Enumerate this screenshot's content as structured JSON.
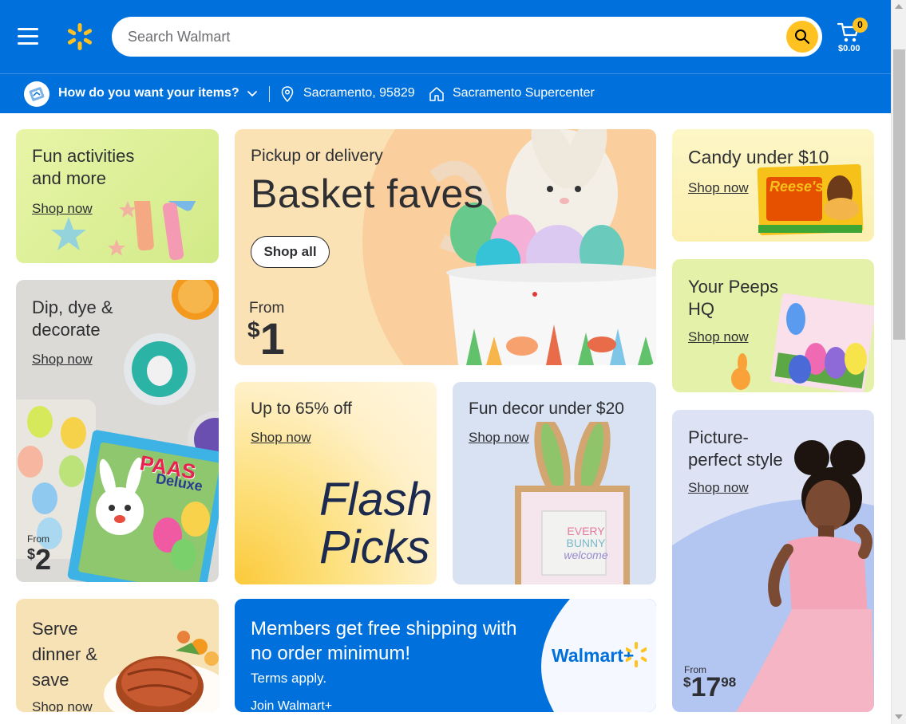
{
  "header": {
    "search_placeholder": "Search Walmart",
    "cart_count": "0",
    "cart_total": "$0.00"
  },
  "subheader": {
    "fulfillment_prompt": "How do you want your items?",
    "location": "Sacramento, 95829",
    "store": "Sacramento Supercenter"
  },
  "cards": {
    "fun_activities": {
      "title_line1": "Fun activities",
      "title_line2": "and more",
      "link": "Shop now"
    },
    "dip_dye": {
      "title_line1": "Dip, dye &",
      "title_line2": "decorate",
      "link": "Shop now",
      "from": "From",
      "price_dollar": "$",
      "price_value": "2",
      "product_text": "PAAS",
      "product_sub": "Deluxe"
    },
    "serve_dinner": {
      "title_line1": "Serve",
      "title_line2": "dinner &",
      "title_line3": "save",
      "link": "Shop now"
    },
    "basket_faves": {
      "eyebrow": "Pickup or delivery",
      "title": "Basket faves",
      "button": "Shop all",
      "from": "From",
      "price_dollar": "$",
      "price_value": "1"
    },
    "flash_picks": {
      "title": "Up to 65% off",
      "link": "Shop now",
      "graphic_line1": "Flash",
      "graphic_line2": "Picks"
    },
    "fun_decor": {
      "title": "Fun decor under $20",
      "link": "Shop now",
      "sign_line1": "EVERY",
      "sign_line2": "BUNNY",
      "sign_line3": "welcome"
    },
    "members": {
      "title_line1": "Members get free shipping with",
      "title_line2": "no order minimum!",
      "subtitle": "Terms apply.",
      "link": "Join Walmart+",
      "logo": "Walmart+"
    },
    "candy": {
      "title": "Candy under $10",
      "link": "Shop now",
      "product_text": "Reese's"
    },
    "peeps": {
      "title_line1": "Your Peeps",
      "title_line2": "HQ",
      "link": "Shop now"
    },
    "picture_perfect": {
      "title_line1": "Picture-",
      "title_line2": "perfect style",
      "link": "Shop now",
      "from": "From",
      "price_dollar": "$",
      "price_value": "17",
      "price_cents": "98"
    }
  },
  "colors": {
    "brand_blue": "#0071dc",
    "spark_yellow": "#ffc220",
    "text_dark": "#2e2f32"
  }
}
